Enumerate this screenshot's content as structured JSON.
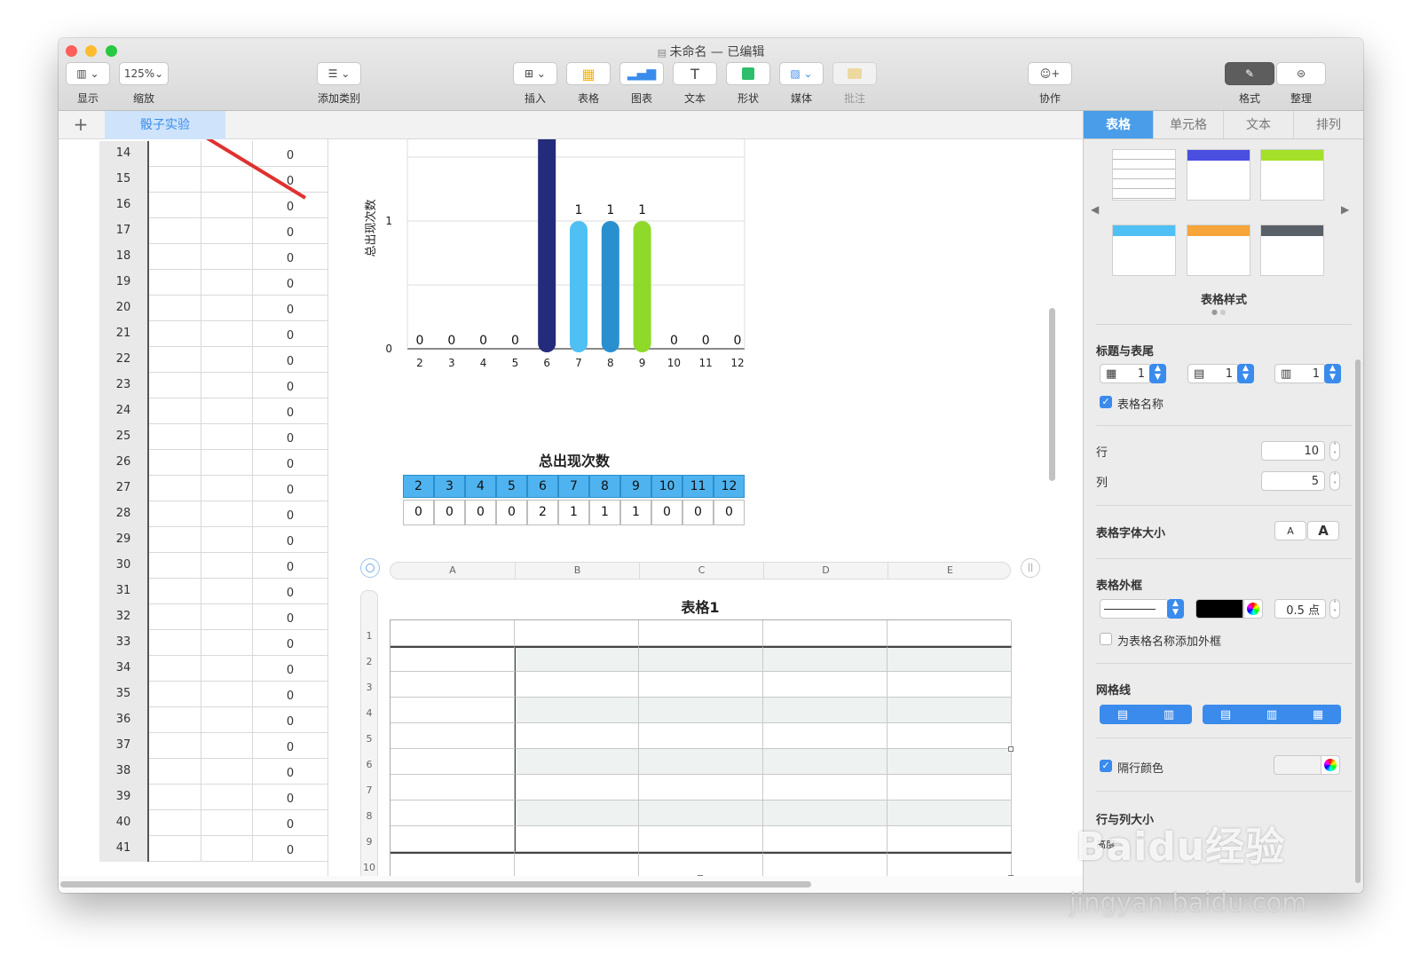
{
  "window": {
    "title": "未命名 — 已编辑"
  },
  "toolbar": {
    "view_label": "显示",
    "zoom_value": "125%",
    "zoom_label": "缩放",
    "category_label": "添加类别",
    "insert_label": "插入",
    "table_label": "表格",
    "chart_label": "图表",
    "text_label": "文本",
    "shape_label": "形状",
    "media_label": "媒体",
    "comment_label": "批注",
    "collab_label": "协作",
    "format_label": "格式",
    "organize_label": "整理"
  },
  "sheets": {
    "add": "+",
    "active": "骰子实验"
  },
  "left_table": {
    "rows": [
      {
        "n": "14",
        "v": "0"
      },
      {
        "n": "15",
        "v": "0"
      },
      {
        "n": "16",
        "v": "0"
      },
      {
        "n": "17",
        "v": "0"
      },
      {
        "n": "18",
        "v": "0"
      },
      {
        "n": "19",
        "v": "0"
      },
      {
        "n": "20",
        "v": "0"
      },
      {
        "n": "21",
        "v": "0"
      },
      {
        "n": "22",
        "v": "0"
      },
      {
        "n": "23",
        "v": "0"
      },
      {
        "n": "24",
        "v": "0"
      },
      {
        "n": "25",
        "v": "0"
      },
      {
        "n": "26",
        "v": "0"
      },
      {
        "n": "27",
        "v": "0"
      },
      {
        "n": "28",
        "v": "0"
      },
      {
        "n": "29",
        "v": "0"
      },
      {
        "n": "30",
        "v": "0"
      },
      {
        "n": "31",
        "v": "0"
      },
      {
        "n": "32",
        "v": "0"
      },
      {
        "n": "33",
        "v": "0"
      },
      {
        "n": "34",
        "v": "0"
      },
      {
        "n": "35",
        "v": "0"
      },
      {
        "n": "36",
        "v": "0"
      },
      {
        "n": "37",
        "v": "0"
      },
      {
        "n": "38",
        "v": "0"
      },
      {
        "n": "39",
        "v": "0"
      },
      {
        "n": "40",
        "v": "0"
      },
      {
        "n": "41",
        "v": "0"
      }
    ]
  },
  "chart_data": {
    "type": "bar",
    "ylabel": "总出现次数",
    "categories": [
      "2",
      "3",
      "4",
      "5",
      "6",
      "7",
      "8",
      "9",
      "10",
      "11",
      "12"
    ],
    "values": [
      0,
      0,
      0,
      0,
      2,
      1,
      1,
      1,
      0,
      0,
      0
    ],
    "data_labels": [
      "0",
      "0",
      "0",
      "0",
      "",
      "1",
      "1",
      "1",
      "0",
      "0",
      "0"
    ],
    "colors": [
      "#2a3a8f",
      "#2a3a8f",
      "#2a3a8f",
      "#2a3a8f",
      "#232b7a",
      "#4fc0f4",
      "#2a8fcf",
      "#8fd92a",
      "#2a3a8f",
      "#2a3a8f",
      "#2a3a8f"
    ],
    "y_ticks": [
      "0",
      "1"
    ],
    "ylim": [
      0,
      2
    ]
  },
  "summary_table": {
    "title": "总出现次数",
    "header": [
      "2",
      "3",
      "4",
      "5",
      "6",
      "7",
      "8",
      "9",
      "10",
      "11",
      "12"
    ],
    "values": [
      "0",
      "0",
      "0",
      "0",
      "2",
      "1",
      "1",
      "1",
      "0",
      "0",
      "0"
    ]
  },
  "new_table": {
    "title": "表格1",
    "columns": [
      "A",
      "B",
      "C",
      "D",
      "E"
    ],
    "rows": [
      "1",
      "2",
      "3",
      "4",
      "5",
      "6",
      "7",
      "8",
      "9",
      "10"
    ]
  },
  "sidebar": {
    "tabs": [
      "表格",
      "单元格",
      "文本",
      "排列"
    ],
    "styles_label": "表格样式",
    "header_footer_label": "标题与表尾",
    "header_rows": "1",
    "header_cols": "1",
    "footer_rows": "1",
    "table_name_label": "表格名称",
    "rows_label": "行",
    "rows_value": "10",
    "cols_label": "列",
    "cols_value": "5",
    "font_size_label": "表格字体大小",
    "font_small": "A",
    "font_large": "A",
    "border_label": "表格外框",
    "border_width": "0.5 点",
    "border_name_label": "为表格名称添加外框",
    "gridlines_label": "网格线",
    "alt_row_label": "隔行颜色",
    "row_col_size_label": "行与列大小",
    "height_label": "高度"
  },
  "watermark": {
    "brand": "Baidu经验",
    "url": "jingyan.baidu.com"
  },
  "colors": {
    "accent": "#4a9de8",
    "annotation_arrow": "#e03131",
    "close": "#fc5f57",
    "minimize": "#fdbc2e",
    "zoom": "#28c840"
  }
}
